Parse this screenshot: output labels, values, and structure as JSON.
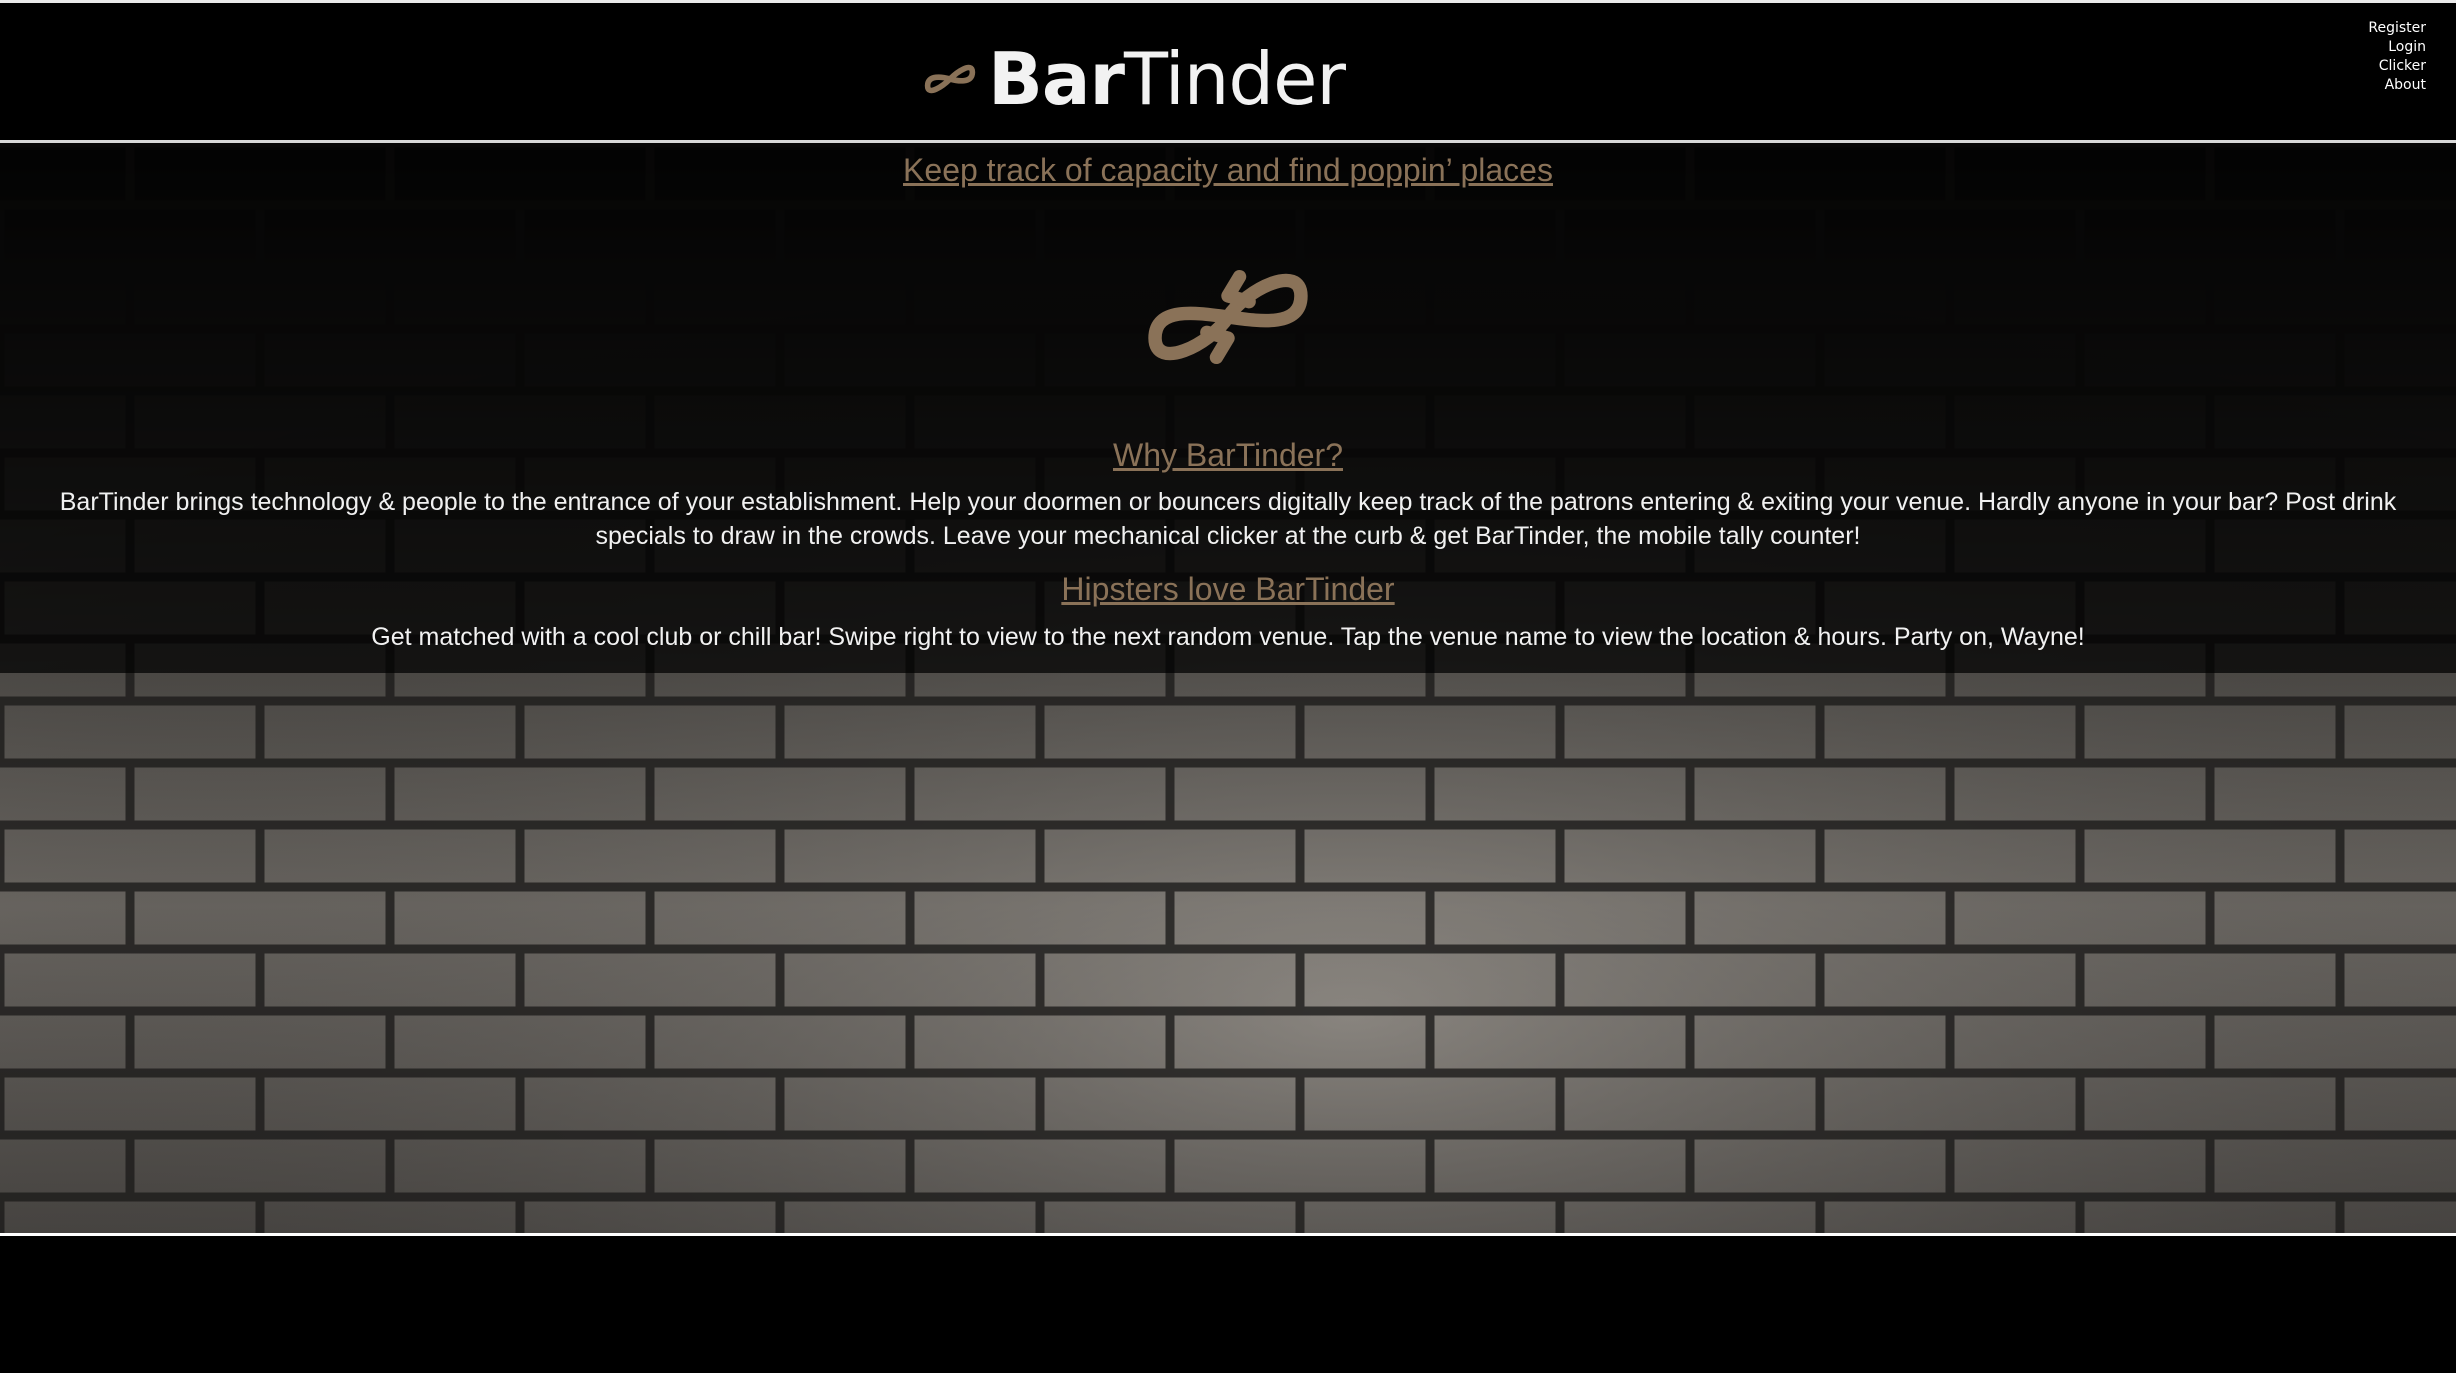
{
  "header": {
    "brand_bold": "Bar",
    "brand_light": "Tinder",
    "nav": [
      "Register",
      "Login",
      "Clicker",
      "About"
    ]
  },
  "main": {
    "tagline": "Keep track of capacity and find poppin’ places",
    "why_heading": "Why BarTinder?",
    "why_text": "BarTinder brings technology & people to the entrance of your establishment. Help your doormen or bouncers digitally keep track of the patrons entering & exiting your venue. Hardly anyone in your bar? Post drink specials to draw in the crowds. Leave your mechanical clicker at the curb & get BarTinder, the mobile tally counter!",
    "hipsters_heading": "Hipsters love BarTinder",
    "hipsters_text": "Get matched with a cool club or chill bar! Swipe right to view to the next random venue. Tap the venue name to view the location & hours. Party on, Wayne!"
  },
  "colors": {
    "accent": "#8a7258",
    "background": "#000000",
    "text": "#f1f1f1"
  },
  "icons": {
    "brand_mark": "infinity-arrows-icon",
    "hero_logo": "infinity-arrows-icon"
  }
}
